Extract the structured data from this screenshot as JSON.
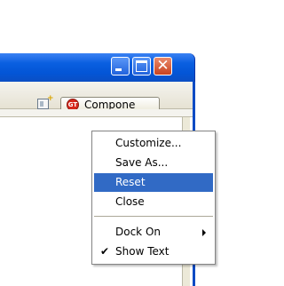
{
  "window": {
    "controls": {
      "minimize": "minimize",
      "maximize": "maximize",
      "close": "close"
    }
  },
  "toolbar": {
    "perspective_icon": "open-perspective-icon",
    "tab_icon": "compose-app-icon",
    "tab_label": "Compone"
  },
  "context_menu": {
    "items": [
      {
        "label": "Customize...",
        "highlighted": false
      },
      {
        "label": "Save As...",
        "highlighted": false
      },
      {
        "label": "Reset",
        "highlighted": true
      },
      {
        "label": "Close",
        "highlighted": false
      },
      {
        "label": "Dock On",
        "highlighted": false,
        "submenu": true
      },
      {
        "label": "Show Text",
        "highlighted": false,
        "checked": true
      }
    ]
  },
  "colors": {
    "titlebar": "#0355d6",
    "menu_highlight": "#316ac5",
    "close_button": "#c8421f"
  }
}
